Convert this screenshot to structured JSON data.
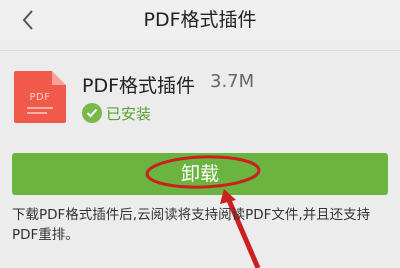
{
  "header": {
    "title": "PDF格式插件"
  },
  "app": {
    "name": "PDF格式插件",
    "size": "3.7M",
    "icon_label": "PDF",
    "status": "已安装"
  },
  "actions": {
    "uninstall_label": "卸载"
  },
  "description": "下载PDF格式插件后,云阅读将支持阅读PDF文件,并且还支持PDF重排。",
  "colors": {
    "accent_green": "#6ab43f",
    "status_green": "#57a233",
    "annotation_red": "#cc1f1f",
    "pdf_icon": "#f15a4a"
  },
  "icons": {
    "back": "chevron-left-icon",
    "status": "check-circle-icon",
    "app": "pdf-file-icon"
  }
}
